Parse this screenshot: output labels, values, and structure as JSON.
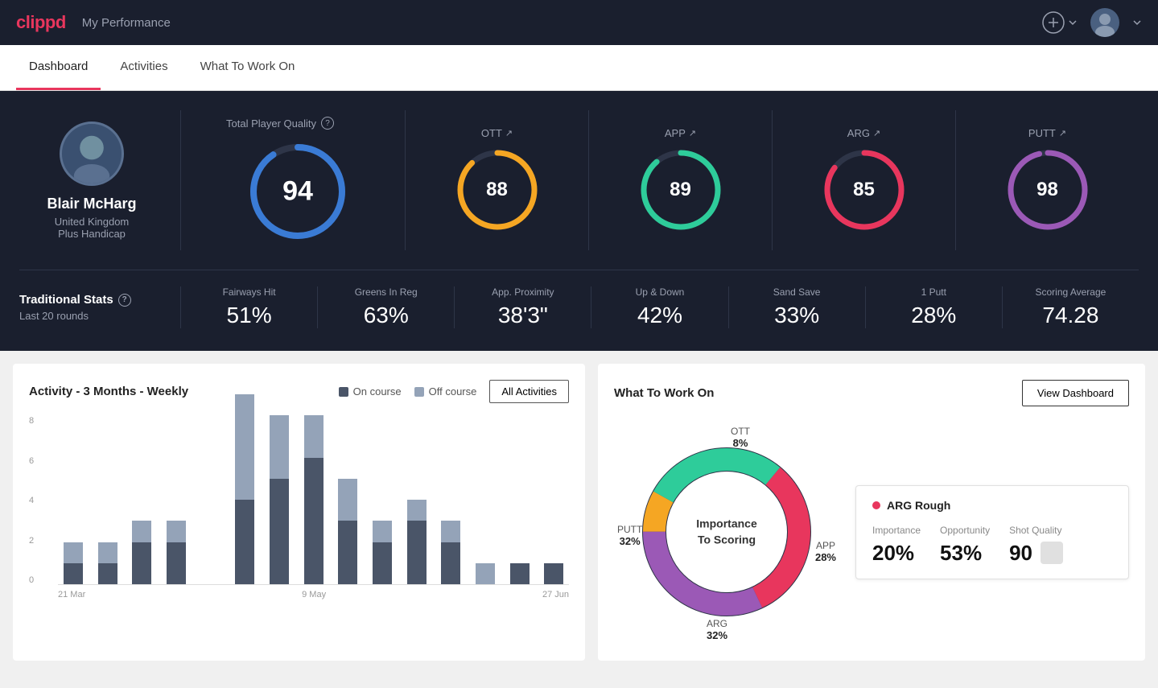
{
  "app": {
    "logo": "clippd",
    "header_title": "My Performance"
  },
  "tabs": [
    {
      "id": "dashboard",
      "label": "Dashboard",
      "active": true
    },
    {
      "id": "activities",
      "label": "Activities",
      "active": false
    },
    {
      "id": "what-to-work-on",
      "label": "What To Work On",
      "active": false
    }
  ],
  "player": {
    "name": "Blair McHarg",
    "country": "United Kingdom",
    "handicap": "Plus Handicap"
  },
  "total_quality": {
    "label": "Total Player Quality",
    "score": 94,
    "color": "#3a7bd5",
    "bg_color": "#1a1f2e",
    "track_color": "#2e3548"
  },
  "category_scores": [
    {
      "id": "ott",
      "label": "OTT",
      "score": 88,
      "color": "#f5a623",
      "track_color": "#2e3548"
    },
    {
      "id": "app",
      "label": "APP",
      "score": 89,
      "color": "#2ecc9a",
      "track_color": "#2e3548"
    },
    {
      "id": "arg",
      "label": "ARG",
      "score": 85,
      "color": "#e8365d",
      "track_color": "#2e3548"
    },
    {
      "id": "putt",
      "label": "PUTT",
      "score": 98,
      "color": "#9b59b6",
      "track_color": "#2e3548"
    }
  ],
  "traditional_stats": {
    "label": "Traditional Stats",
    "sublabel": "Last 20 rounds",
    "stats": [
      {
        "id": "fairways-hit",
        "label": "Fairways Hit",
        "value": "51%"
      },
      {
        "id": "greens-in-reg",
        "label": "Greens In Reg",
        "value": "63%"
      },
      {
        "id": "app-proximity",
        "label": "App. Proximity",
        "value": "38'3\""
      },
      {
        "id": "up-down",
        "label": "Up & Down",
        "value": "42%"
      },
      {
        "id": "sand-save",
        "label": "Sand Save",
        "value": "33%"
      },
      {
        "id": "one-putt",
        "label": "1 Putt",
        "value": "28%"
      },
      {
        "id": "scoring-avg",
        "label": "Scoring Average",
        "value": "74.28"
      }
    ]
  },
  "activity_chart": {
    "title": "Activity - 3 Months - Weekly",
    "legend": [
      {
        "id": "on-course",
        "label": "On course",
        "color": "#4a5568"
      },
      {
        "id": "off-course",
        "label": "Off course",
        "color": "#94a3b8"
      }
    ],
    "all_activities_label": "All Activities",
    "y_labels": [
      "8",
      "6",
      "4",
      "2",
      "0"
    ],
    "x_labels": [
      "21 Mar",
      "9 May",
      "27 Jun"
    ],
    "bars": [
      {
        "on": 1,
        "off": 1
      },
      {
        "on": 1,
        "off": 1
      },
      {
        "on": 2,
        "off": 1
      },
      {
        "on": 2,
        "off": 1
      },
      {
        "on": 0,
        "off": 0
      },
      {
        "on": 4,
        "off": 5
      },
      {
        "on": 5,
        "off": 3
      },
      {
        "on": 6,
        "off": 2
      },
      {
        "on": 3,
        "off": 2
      },
      {
        "on": 2,
        "off": 1
      },
      {
        "on": 3,
        "off": 1
      },
      {
        "on": 2,
        "off": 1
      },
      {
        "on": 0,
        "off": 1
      },
      {
        "on": 1,
        "off": 0
      },
      {
        "on": 1,
        "off": 0
      }
    ]
  },
  "what_to_work_on": {
    "title": "What To Work On",
    "view_dashboard_label": "View Dashboard",
    "donut_center": "Importance\nTo Scoring",
    "segments": [
      {
        "id": "ott",
        "label": "OTT",
        "pct": "8%",
        "color": "#f5a623",
        "value": 8
      },
      {
        "id": "app",
        "label": "APP",
        "pct": "28%",
        "color": "#2ecc9a",
        "value": 28
      },
      {
        "id": "arg",
        "label": "ARG",
        "pct": "32%",
        "color": "#e8365d",
        "value": 32
      },
      {
        "id": "putt",
        "label": "PUTT",
        "pct": "32%",
        "color": "#9b59b6",
        "value": 32
      }
    ],
    "highlight_card": {
      "title": "ARG Rough",
      "color": "#e8365d",
      "stats": [
        {
          "label": "Importance",
          "value": "20%"
        },
        {
          "label": "Opportunity",
          "value": "53%"
        },
        {
          "label": "Shot Quality",
          "value": "90"
        }
      ]
    }
  }
}
